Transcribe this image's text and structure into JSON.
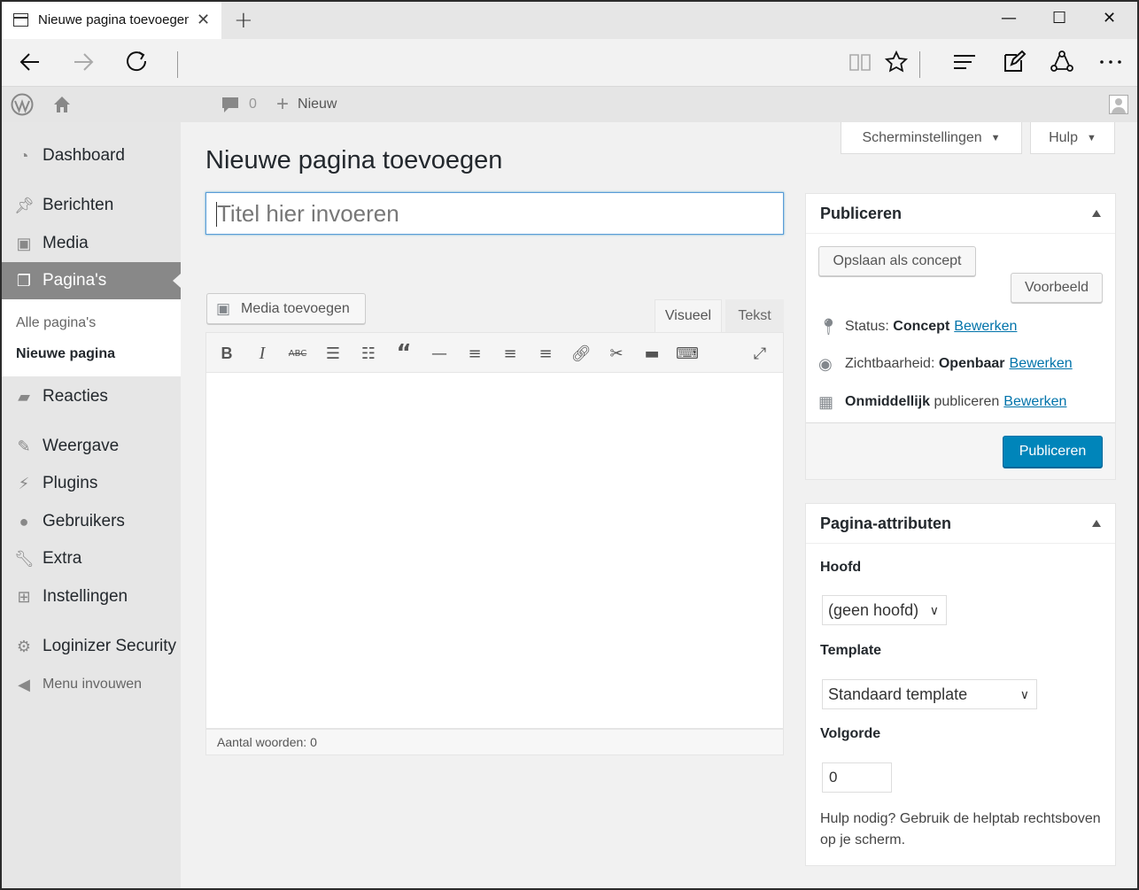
{
  "browser": {
    "tab_title": "Nieuwe pagina toevoegen",
    "tab_close": "✕",
    "new_tab": "+",
    "minimize": "—",
    "maximize": "☐",
    "close": "✕"
  },
  "adminbar": {
    "comments_count": "0",
    "new_label": "Nieuw"
  },
  "sidebar": {
    "items": [
      {
        "label": "Dashboard",
        "icon": "dashboard-icon"
      },
      {
        "label": "Berichten",
        "icon": "pin-icon"
      },
      {
        "label": "Media",
        "icon": "media-icon"
      },
      {
        "label": "Pagina's",
        "icon": "pages-icon"
      },
      {
        "label": "Reacties",
        "icon": "comment-icon"
      },
      {
        "label": "Weergave",
        "icon": "brush-icon"
      },
      {
        "label": "Plugins",
        "icon": "plugin-icon"
      },
      {
        "label": "Gebruikers",
        "icon": "user-icon"
      },
      {
        "label": "Extra",
        "icon": "wrench-icon"
      },
      {
        "label": "Instellingen",
        "icon": "settings-icon"
      },
      {
        "label": "Loginizer Security",
        "icon": "gear-icon"
      }
    ],
    "submenu": [
      "Alle pagina's",
      "Nieuwe pagina"
    ],
    "collapse": "Menu invouwen"
  },
  "header": {
    "screen_options": "Scherminstellingen",
    "help": "Hulp",
    "page_title": "Nieuwe pagina toevoegen"
  },
  "editor": {
    "title_placeholder": "Titel hier invoeren",
    "media_button": "Media toevoegen",
    "tab_visual": "Visueel",
    "tab_text": "Tekst",
    "word_count": "Aantal woorden: 0"
  },
  "publish": {
    "heading": "Publiceren",
    "save_draft": "Opslaan als concept",
    "preview": "Voorbeeld",
    "status_label": "Status:",
    "status_value": "Concept",
    "visibility_label": "Zichtbaarheid:",
    "visibility_value": "Openbaar",
    "schedule_bold": "Onmiddellijk",
    "schedule_label": "publiceren",
    "edit": "Bewerken",
    "publish_button": "Publiceren"
  },
  "attributes": {
    "heading": "Pagina-attributen",
    "parent_label": "Hoofd",
    "parent_value": "(geen hoofd)",
    "template_label": "Template",
    "template_value": "Standaard template",
    "order_label": "Volgorde",
    "order_value": "0",
    "help_text": "Hulp nodig? Gebruik de helptab rechtsboven op je scherm."
  }
}
